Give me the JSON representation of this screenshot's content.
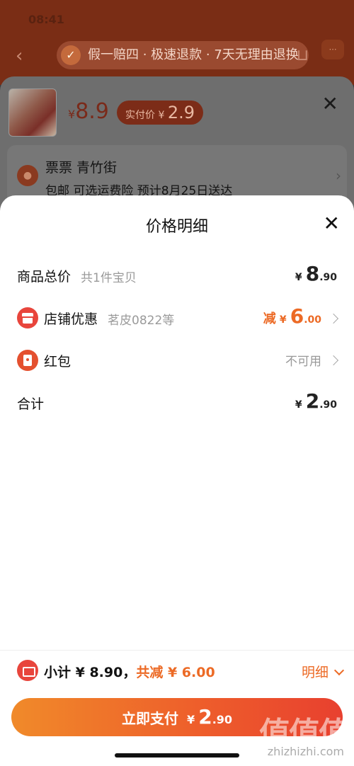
{
  "background": {
    "status_text": "08:41",
    "guarantee": "假一赔四 · 极速退款 · 7天无理由退换",
    "product": {
      "price_symbol": "¥",
      "price": "8.9",
      "paid_label": "实付价",
      "paid_symbol": "¥",
      "paid_price": "2.9"
    },
    "address": {
      "name": "票票  青竹街",
      "shipping": "包邮  可选运费险  预计8月25日送达"
    }
  },
  "sheet": {
    "title": "价格明细",
    "rows": {
      "total": {
        "label": "商品总价",
        "sub": "共1件宝贝",
        "symbol": "¥",
        "int": "8",
        "dec": ".90"
      },
      "shop": {
        "label": "店铺优惠",
        "sub": "茗皮0822等",
        "prefix": "减",
        "symbol": "¥",
        "int": "6",
        "dec": ".00"
      },
      "redpacket": {
        "label": "红包",
        "value": "不可用"
      },
      "sum": {
        "label": "合计",
        "symbol": "¥",
        "int": "2",
        "dec": ".90"
      }
    }
  },
  "footer": {
    "subtotal": "小计 ¥ 8.90，",
    "saving": "共减 ¥ 6.00",
    "detail_label": "明细",
    "pay_label": "立即支付",
    "pay_symbol": "¥",
    "pay_int": "2",
    "pay_dec": ".90"
  },
  "watermark": {
    "text": "值值值",
    "url": "zhizhizhi.com"
  },
  "colors": {
    "accent": "#ec6a25",
    "icon_red": "#e8453c"
  }
}
